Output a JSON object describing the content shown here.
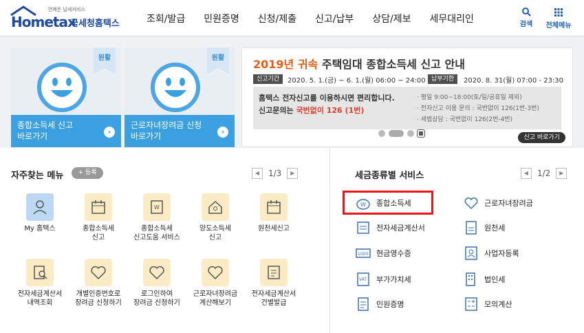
{
  "header": {
    "logo_sub": "언제든 납세서비스",
    "logo_main": "Hometax",
    "logo_kr": "국세청홈택스",
    "nav": [
      "조회/발급",
      "민원증명",
      "신청/제출",
      "신고/납부",
      "상담/제보",
      "세무대리인"
    ],
    "search_label": "검색",
    "menu_label": "전체메뉴"
  },
  "cards": [
    {
      "badge": "원활",
      "line1": "종합소득세 신고",
      "line2": "바로가기"
    },
    {
      "badge": "원활",
      "line1": "근로자녀장려금 신청",
      "line2": "바로가기"
    }
  ],
  "banner": {
    "year": "2019년 귀속",
    "title": "주택임대 종합소득세 신고 안내",
    "tag1": "신고기간",
    "period": "2020. 5. 1.(금) ~ 6. 1.(월) 06:00 ~ 24:00",
    "tag2": "납부기한",
    "due": "2020. 8. 31(월) 07:00 - 23:30",
    "box_l1": "홈택스 전자신고를 이용하시면 편리합니다.",
    "box_l2a": "신고문의는 ",
    "box_l2b": "국번없이 126 (1번)",
    "box_r": [
      "· 평일 9:00~18:00(토/일/공휴일 제외)",
      "· 전자신고 이용 문의 : 국번없이 126(1번-3번)",
      "· 세법상담 : 국번없이 126(2번-4번)"
    ],
    "link": "신고 바로가기"
  },
  "favorites": {
    "title": "자주찾는 메뉴",
    "add": "+ 등록",
    "page": "1/3",
    "tiles": [
      {
        "l1": "My 홈택스",
        "l2": ""
      },
      {
        "l1": "종합소득세",
        "l2": "신고"
      },
      {
        "l1": "종합소득세",
        "l2": "신고도움 서비스"
      },
      {
        "l1": "양도소득세",
        "l2": "신고"
      },
      {
        "l1": "원천세신고",
        "l2": ""
      },
      {
        "l1": "전자세금계산서",
        "l2": "내역조회"
      },
      {
        "l1": "개별인증번호로",
        "l2": "장려금 신청하기"
      },
      {
        "l1": "로그인하여",
        "l2": "장려금 신청하기"
      },
      {
        "l1": "근로자녀장려금",
        "l2": "계산해보기"
      },
      {
        "l1": "전자세금계산서",
        "l2": "건별발급"
      }
    ]
  },
  "services": {
    "title": "세금종류별 서비스",
    "page": "1/2",
    "items": [
      "종합소득세",
      "근로자녀장려금",
      "전자세금계산서",
      "원천세",
      "현금영수증",
      "사업자등록",
      "부가가치세",
      "법인세",
      "민원증명",
      "모의계산"
    ]
  },
  "colors": {
    "brand": "#1d4a9e",
    "accent": "#3aa0df",
    "orange": "#e65a13",
    "highlight": "#e8161b"
  }
}
